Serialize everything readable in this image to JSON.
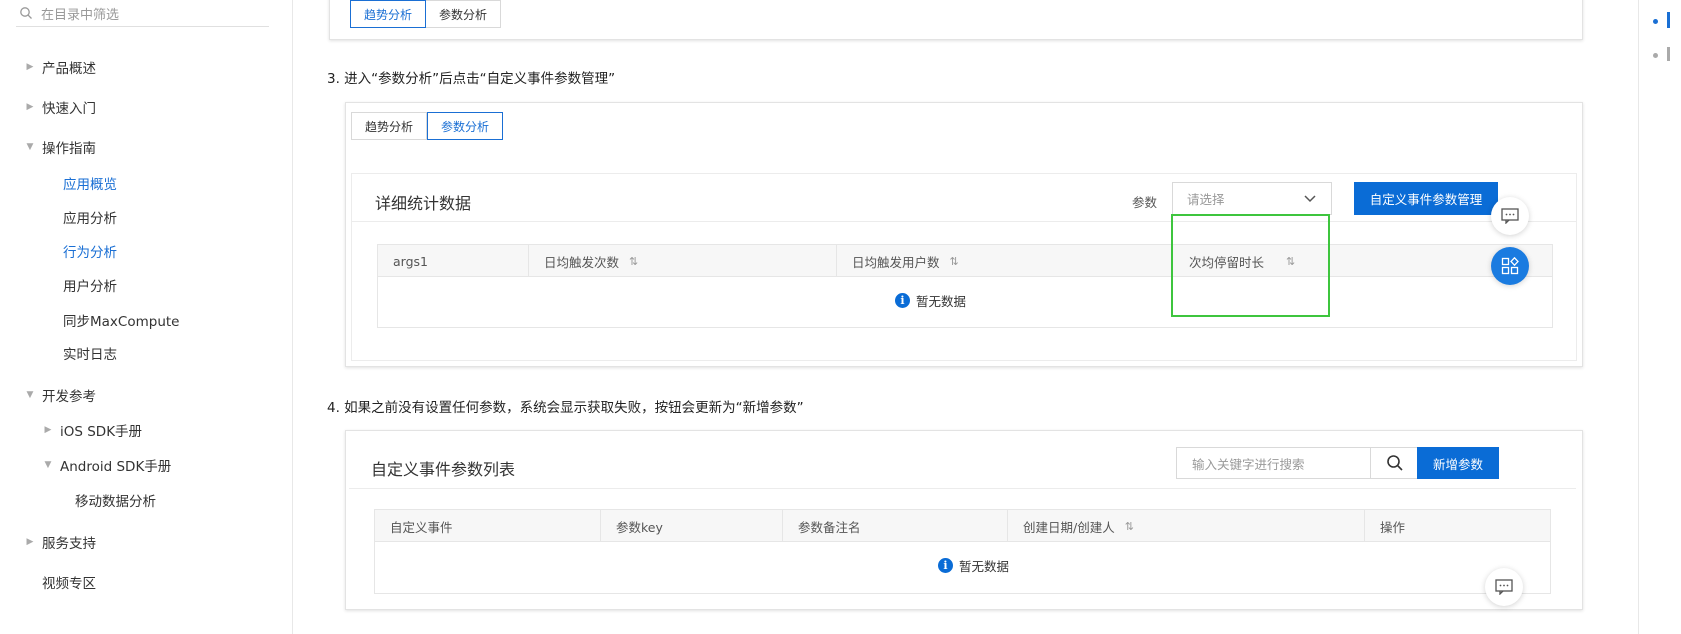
{
  "sidebar": {
    "search_placeholder": "在目录中筛选",
    "items": [
      {
        "label": "产品概述"
      },
      {
        "label": "快速入门"
      },
      {
        "label": "操作指南"
      },
      {
        "label": "应用概览"
      },
      {
        "label": "应用分析"
      },
      {
        "label": "行为分析"
      },
      {
        "label": "用户分析"
      },
      {
        "label": "同步MaxCompute"
      },
      {
        "label": "实时日志"
      },
      {
        "label": "开发参考"
      },
      {
        "label": "iOS SDK手册"
      },
      {
        "label": "Android SDK手册"
      },
      {
        "label": "移动数据分析"
      },
      {
        "label": "服务支持"
      },
      {
        "label": "视频专区"
      }
    ]
  },
  "top_card": {
    "tabs": [
      "趋势分析",
      "参数分析"
    ]
  },
  "step3": {
    "text": "3. 进入“参数分析”后点击“自定义事件参数管理”",
    "tabs": [
      "趋势分析",
      "参数分析"
    ],
    "panel_title": "详细统计数据",
    "param_label": "参数",
    "select_placeholder": "请选择",
    "manage_button": "自定义事件参数管理",
    "columns": [
      "args1",
      "日均触发次数",
      "日均触发用户数",
      "次均停留时长"
    ],
    "empty_text": "暂无数据"
  },
  "step4": {
    "text": "4. 如果之前没有设置任何参数，系统会显示获取失败，按钮会更新为“新增参数”",
    "panel_title": "自定义事件参数列表",
    "search_placeholder": "输入关键字进行搜索",
    "add_button": "新增参数",
    "columns": [
      "自定义事件",
      "参数key",
      "参数备注名",
      "创建日期/创建人",
      "操作"
    ],
    "empty_text": "暂无数据"
  },
  "colors": {
    "accent": "#0a6cd6",
    "highlight": "#3ec53e"
  }
}
